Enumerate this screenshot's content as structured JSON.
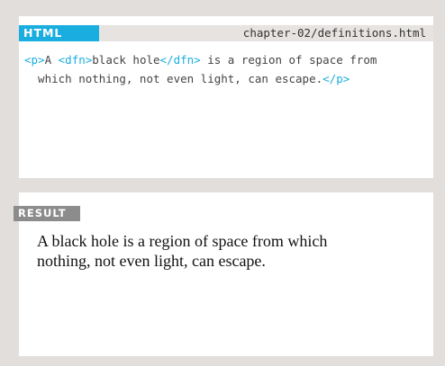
{
  "code_panel": {
    "tab_label": "HTML",
    "filename": "chapter-02/definitions.html",
    "code": {
      "p_open": "<p>",
      "text_a": "A ",
      "dfn_open": "<dfn>",
      "term": "black hole",
      "dfn_close": "</dfn>",
      "text_rest_line1": " is a region of space from",
      "text_line2": "  which nothing, not even light, can escape.",
      "p_close": "</p>"
    }
  },
  "result_panel": {
    "tab_label": "RESULT",
    "text_line1": "A black hole is a region of space from which",
    "text_line2": "nothing, not even light, can escape."
  },
  "colors": {
    "page_background": "#e2dedc",
    "html_tab": "#1aaee0",
    "result_tab": "#8c8c8c",
    "code_tag": "#1aaee0"
  }
}
